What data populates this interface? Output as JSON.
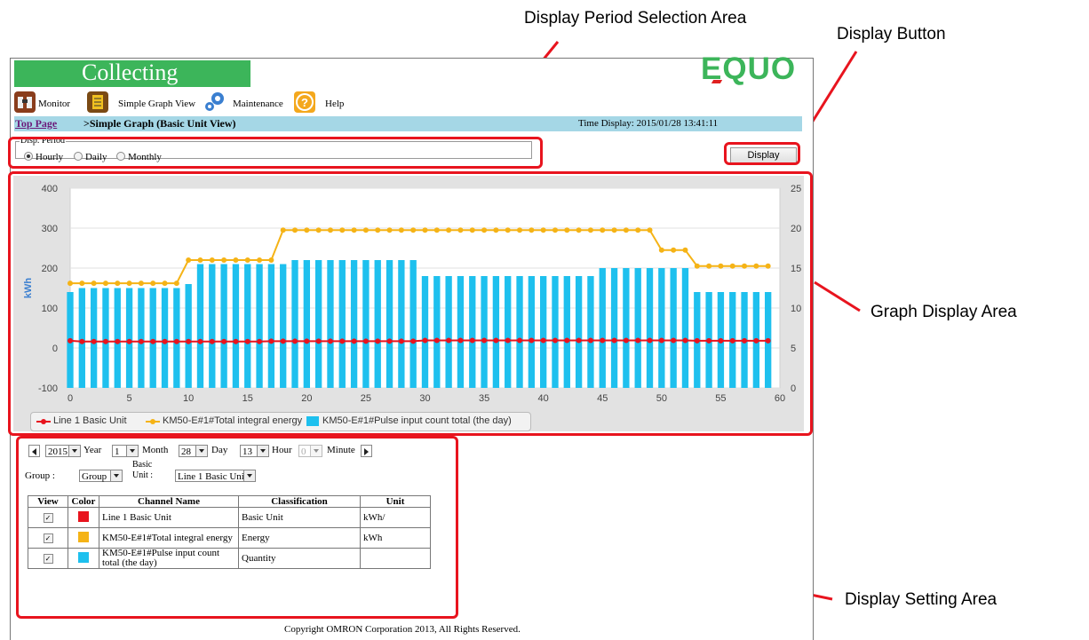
{
  "callouts": {
    "period_area": "Display Period Selection Area",
    "display_button": "Display Button",
    "graph_area": "Graph Display Area",
    "setting_area": "Display Setting Area"
  },
  "app": {
    "status_title": "Collecting",
    "logo": "EQUO"
  },
  "nav": {
    "monitor": "Monitor",
    "simple_graph": "Simple Graph View",
    "maintenance": "Maintenance",
    "help": "Help"
  },
  "breadcrumb": {
    "top_page": "Top Page",
    "current": ">Simple Graph (Basic Unit View)",
    "time_display": "Time Display:  2015/01/28 13:41:11"
  },
  "period": {
    "legend": "Disp. Period",
    "options": [
      "Hourly",
      "Daily",
      "Monthly"
    ],
    "selected": "Hourly"
  },
  "display_button": "Display",
  "chart_data": {
    "type": "bar",
    "ylabel": "kWh",
    "ylim_left": [
      -100,
      400
    ],
    "yticks_left": [
      "400",
      "300",
      "200",
      "100",
      "0",
      "-100"
    ],
    "ylim_right": [
      0,
      25
    ],
    "yticks_right": [
      "25",
      "20",
      "15",
      "10",
      "5",
      "0"
    ],
    "xlim": [
      0,
      60
    ],
    "xticks": [
      "0",
      "5",
      "10",
      "15",
      "20",
      "25",
      "30",
      "35",
      "40",
      "45",
      "50",
      "55",
      "60"
    ],
    "x": [
      0,
      1,
      2,
      3,
      4,
      5,
      6,
      7,
      8,
      9,
      10,
      11,
      12,
      13,
      14,
      15,
      16,
      17,
      18,
      19,
      20,
      21,
      22,
      23,
      24,
      25,
      26,
      27,
      28,
      29,
      30,
      31,
      32,
      33,
      34,
      35,
      36,
      37,
      38,
      39,
      40,
      41,
      42,
      43,
      44,
      45,
      46,
      47,
      48,
      49,
      50,
      51,
      52,
      53,
      54,
      55,
      56,
      57,
      58,
      59
    ],
    "grid": true,
    "series": [
      {
        "name": "Line 1 Basic Unit",
        "kind": "line",
        "axis": "left",
        "color": "#e8141e",
        "values": [
          18,
          16,
          16,
          16,
          16,
          16,
          16,
          16,
          16,
          16,
          16,
          16,
          16,
          16,
          16,
          16,
          16,
          17,
          17,
          17,
          17,
          17,
          17,
          17,
          17,
          17,
          17,
          17,
          17,
          17,
          19,
          19,
          19,
          19,
          19,
          19,
          19,
          19,
          19,
          19,
          19,
          19,
          19,
          19,
          19,
          19,
          19,
          19,
          19,
          19,
          19,
          19,
          19,
          18,
          18,
          18,
          18,
          18,
          18,
          18
        ]
      },
      {
        "name": "KM50-E#1#Total integral energy",
        "kind": "line",
        "axis": "left",
        "color": "#f5b316",
        "values": [
          162,
          162,
          162,
          162,
          162,
          162,
          162,
          162,
          162,
          162,
          220,
          220,
          220,
          220,
          220,
          220,
          220,
          220,
          295,
          295,
          295,
          295,
          295,
          295,
          295,
          295,
          295,
          295,
          295,
          295,
          295,
          295,
          295,
          295,
          295,
          295,
          295,
          295,
          295,
          295,
          295,
          295,
          295,
          295,
          295,
          295,
          295,
          295,
          295,
          295,
          245,
          245,
          245,
          205,
          205,
          205,
          205,
          205,
          205,
          205
        ]
      },
      {
        "name": "KM50-E#1#Pulse input count total (the day)",
        "kind": "bar",
        "axis": "right",
        "color": "#1ec0ee",
        "values": [
          12,
          12.5,
          12.5,
          12.5,
          12.5,
          12.5,
          12.5,
          12.5,
          12.5,
          12.5,
          13,
          15.5,
          15.5,
          15.5,
          15.5,
          15.5,
          15.5,
          15.5,
          15.5,
          16,
          16,
          16,
          16,
          16,
          16,
          16,
          16,
          16,
          16,
          16,
          14,
          14,
          14,
          14,
          14,
          14,
          14,
          14,
          14,
          14,
          14,
          14,
          14,
          14,
          14,
          15,
          15,
          15,
          15,
          15,
          15,
          15,
          15,
          12,
          12,
          12,
          12,
          12,
          12,
          12
        ]
      }
    ]
  },
  "settings": {
    "year_value": "2015",
    "year_label": "Year",
    "month_value": "1",
    "month_label": "Month",
    "day_value": "28",
    "day_label": "Day",
    "hour_value": "13",
    "hour_label": "Hour",
    "minute_value": "0",
    "minute_label": "Minute",
    "group_label": "Group :",
    "group_value": "Group",
    "basic_unit_label_1": "Basic",
    "basic_unit_label_2": "Unit :",
    "basic_unit_value": "Line 1 Basic Unit"
  },
  "table": {
    "headers": [
      "View",
      "Color",
      "Channel Name",
      "Classification",
      "Unit"
    ],
    "rows": [
      {
        "checked": "✓",
        "color": "#e8141e",
        "name": "Line 1 Basic Unit",
        "classification": "Basic Unit",
        "unit": "kWh/"
      },
      {
        "checked": "✓",
        "color": "#f5b316",
        "name": "KM50-E#1#Total integral energy",
        "classification": "Energy",
        "unit": "kWh"
      },
      {
        "checked": "✓",
        "color": "#1ec0ee",
        "name": "KM50-E#1#Pulse input count total (the day)",
        "classification": "Quantity",
        "unit": ""
      }
    ]
  },
  "copyright": "Copyright OMRON Corporation 2013, All Rights Reserved."
}
